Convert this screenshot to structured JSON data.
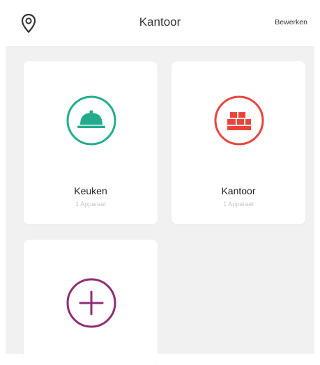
{
  "header": {
    "title": "Kantoor",
    "edit_label": "Bewerken",
    "location_icon": "location-pin-icon"
  },
  "rooms": [
    {
      "name": "Keuken",
      "count": "1 Apparaat",
      "icon": "cloche-icon",
      "color": "#22ac8c"
    },
    {
      "name": "Kantoor",
      "count": "1 Apparaat",
      "icon": "office-icon",
      "color": "#e8443c"
    }
  ],
  "add_room": {
    "icon": "plus-icon",
    "color": "#8e2d75"
  },
  "colors": {
    "background": "#f1f1f1",
    "card": "#ffffff"
  }
}
